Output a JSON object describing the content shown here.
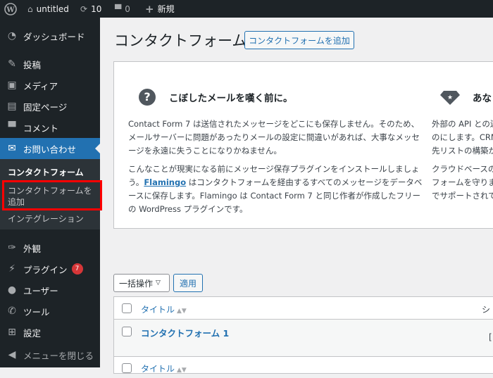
{
  "adminbar": {
    "site": "untitled",
    "updates": "10",
    "comments": "0",
    "new": "新規"
  },
  "sidebar": {
    "items": [
      {
        "label": "ダッシュボード",
        "icon": "dashboard-icon"
      },
      {
        "label": "投稿",
        "icon": "pin-icon"
      },
      {
        "label": "メディア",
        "icon": "media-icon"
      },
      {
        "label": "固定ページ",
        "icon": "page-icon"
      },
      {
        "label": "コメント",
        "icon": "comment-icon"
      },
      {
        "label": "お問い合わせ",
        "icon": "mail-icon"
      },
      {
        "label": "外観",
        "icon": "brush-icon"
      },
      {
        "label": "プラグイン",
        "icon": "plugin-icon",
        "badge": "7"
      },
      {
        "label": "ユーザー",
        "icon": "user-icon"
      },
      {
        "label": "ツール",
        "icon": "wrench-icon"
      },
      {
        "label": "設定",
        "icon": "settings-icon"
      },
      {
        "label": "メニューを閉じる",
        "icon": "collapse-icon"
      }
    ],
    "submenu": [
      "コンタクトフォーム",
      "コンタクトフォームを",
      "追加",
      "インテグレーション"
    ]
  },
  "main": {
    "title": "コンタクトフォーム",
    "add_button": "コンタクトフォームを追加",
    "card": {
      "left": {
        "heading": "こぼしたメールを嘆く前に。",
        "p1": "Contact Form 7 は送信されたメッセージをどこにも保存しません。そのため、メールサーバーに問題があったりメールの設定に間違いがあれば、大事なメッセージを永遠に失うことになりかねません。",
        "p2a": "こんなことが現実になる前にメッセージ保存プラグインをインストールしましょう。",
        "link": "Flamingo",
        "p2b": " はコンタクトフォームを経由するすべてのメッセージをデータベースに保存します。Flamingo は Contact Form 7 と同じ作者が作成したフリーの WordPress プラグインです。"
      },
      "right": {
        "heading": "あな",
        "p1": [
          "外部の API との連",
          "のにします。CRM",
          "先リストの構築が"
        ],
        "p2": [
          "クラウドベースの",
          "フォームを守りま",
          "でサポートされて"
        ]
      }
    },
    "bulk": "一括操作",
    "apply": "適用",
    "table": {
      "col_title": "タイトル",
      "col2": "シ",
      "row_title": "コンタクトフォーム 1",
      "row_col2": "["
    }
  }
}
